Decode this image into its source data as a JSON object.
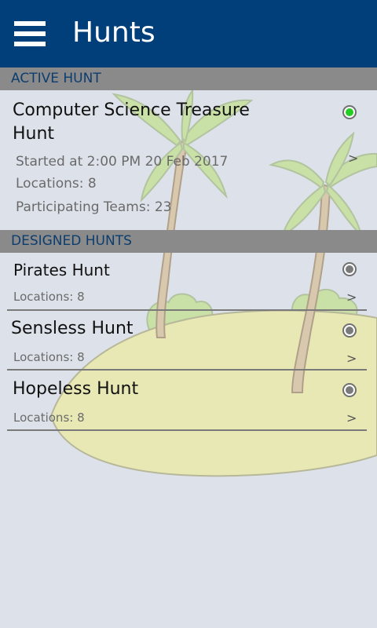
{
  "appbar": {
    "title": "Hunts",
    "menu_icon": "menu-icon"
  },
  "active_section": {
    "label": "ACTIVE HUNT"
  },
  "active_hunt": {
    "title_line1": "Computer Science Treasure",
    "title_line2": "Hunt",
    "started": "Started at 2:00 PM 20 Feb 2017",
    "locations": "Locations: 8",
    "teams": "Participating Teams: 23",
    "chevron": ">",
    "status_color": "#22cc22"
  },
  "designed_section": {
    "label": "DESIGNED HUNTS"
  },
  "designed_hunts": [
    {
      "title": "Pirates Hunt",
      "locations": "Locations: 8",
      "chevron": ">"
    },
    {
      "title": "Sensless Hunt",
      "locations": "Locations: 8",
      "chevron": ">"
    },
    {
      "title": "Hopeless Hunt",
      "locations": "Locations: 8",
      "chevron": ">"
    }
  ],
  "colors": {
    "appbar": "#003f7a",
    "section_header": "#8a8a8a",
    "section_text": "#0d3d6e",
    "background": "#dde2ea",
    "sand": "#e8e8b4",
    "foliage": "#c9e0a6"
  }
}
